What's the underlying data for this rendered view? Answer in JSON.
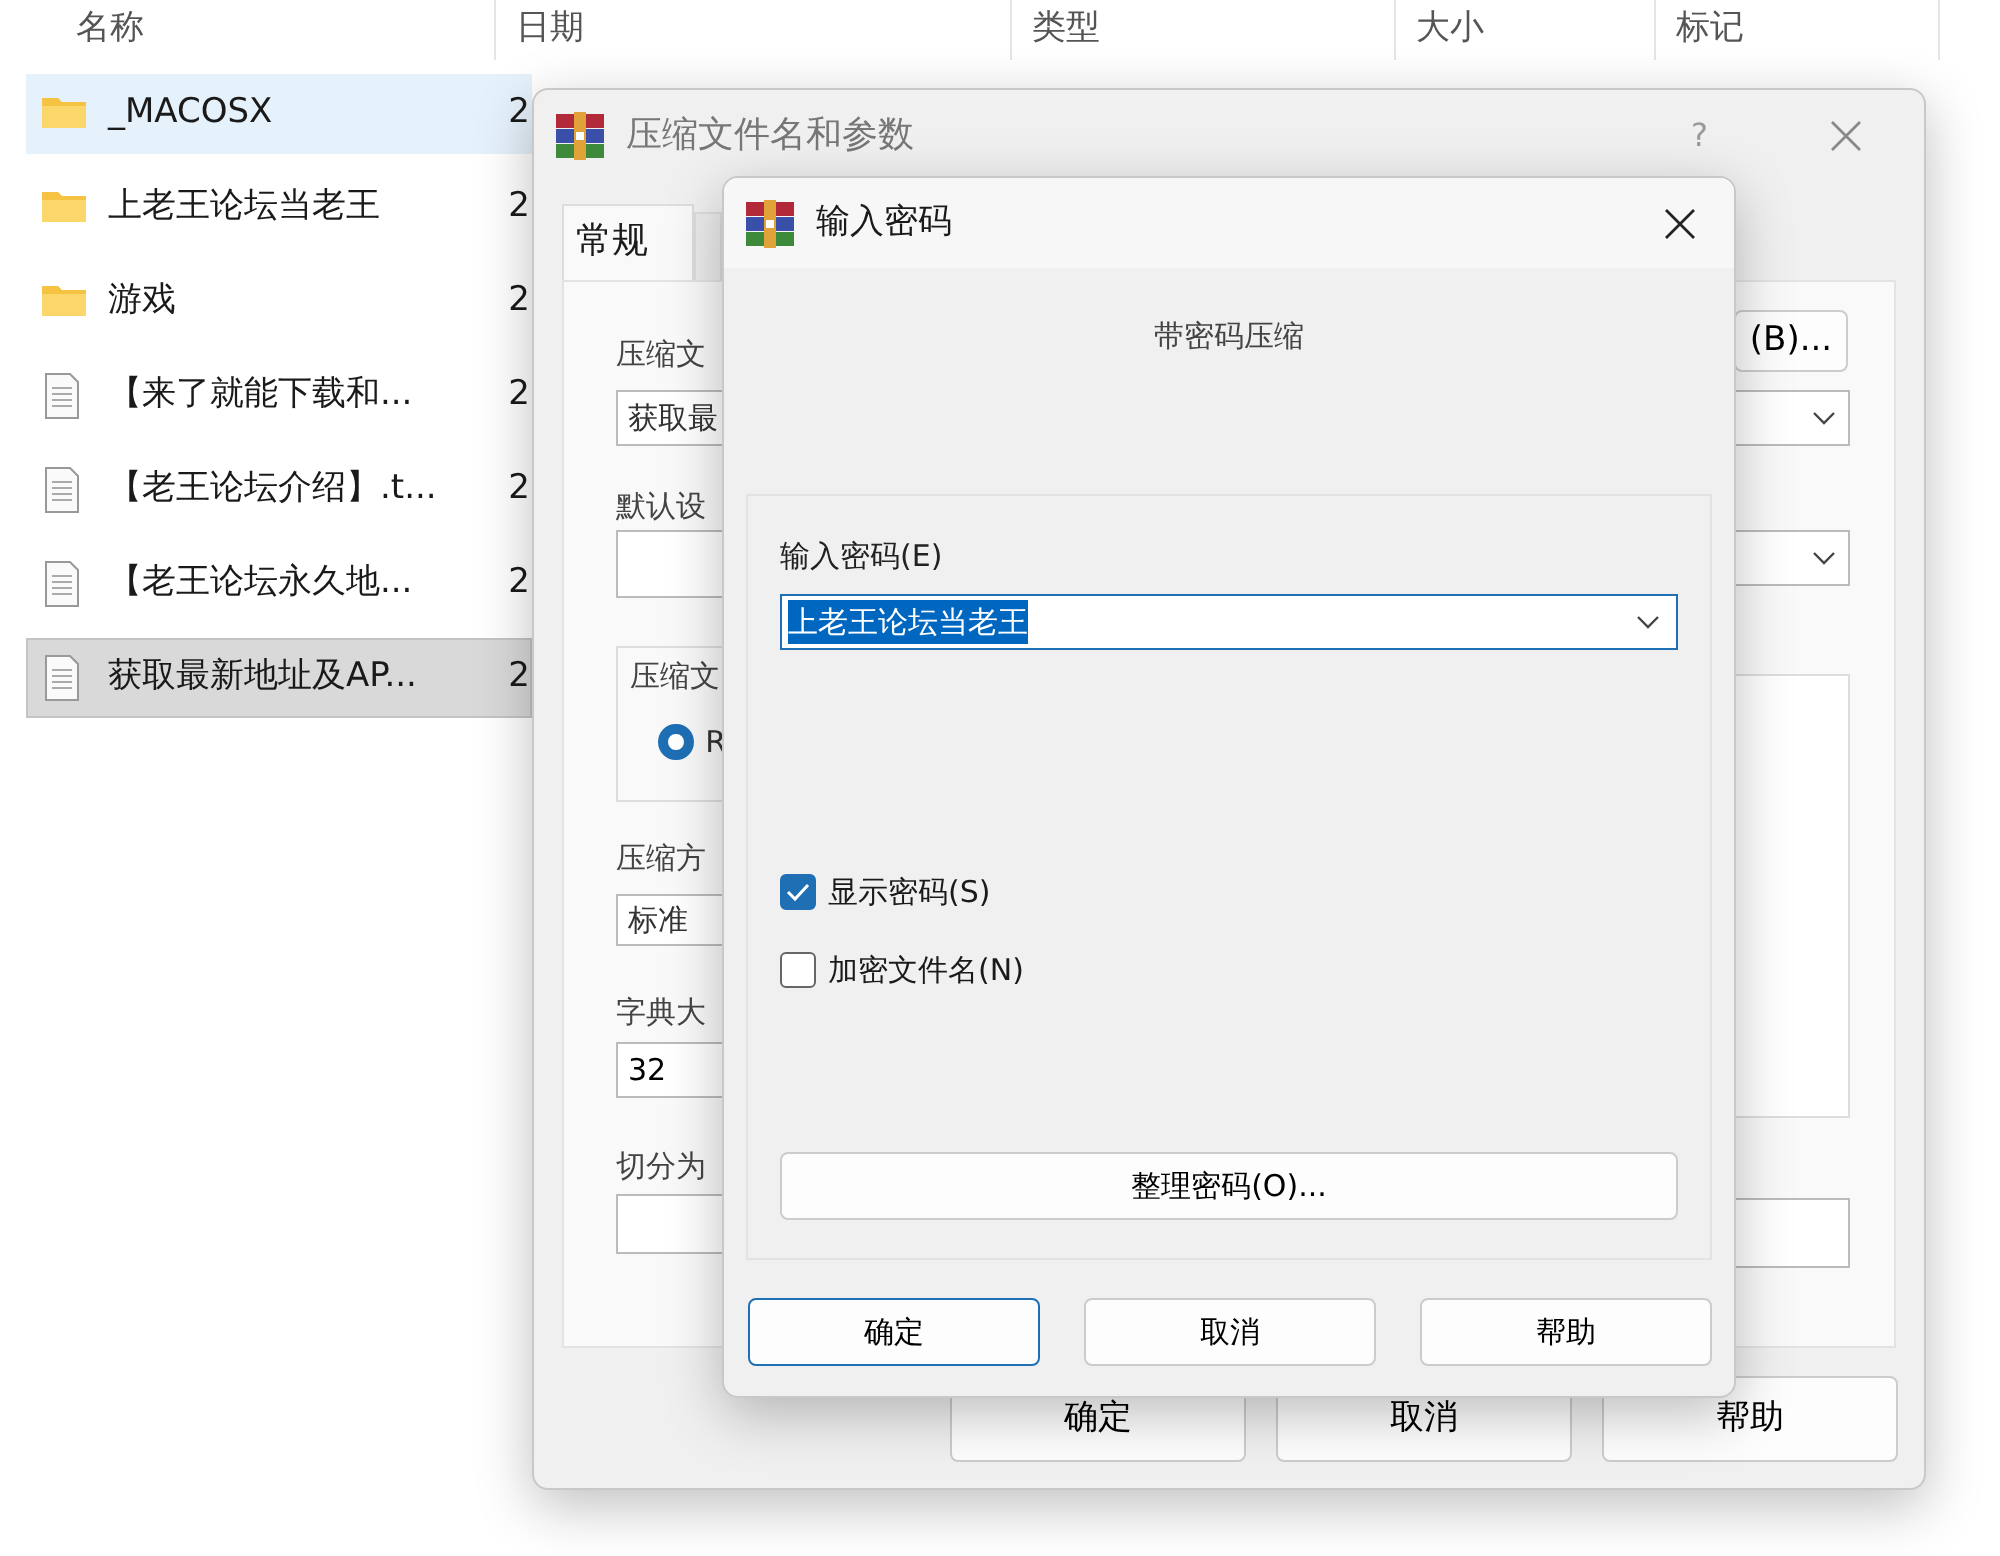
{
  "explorer": {
    "columns": [
      "名称",
      "日期",
      "类型",
      "大小",
      "标记"
    ],
    "rows": [
      {
        "kind": "folder",
        "name": "_MACOSX",
        "date": "2",
        "hovered": true,
        "selected": false
      },
      {
        "kind": "folder",
        "name": "上老王论坛当老王",
        "date": "2",
        "hovered": false,
        "selected": false
      },
      {
        "kind": "folder",
        "name": "游戏",
        "date": "2",
        "hovered": false,
        "selected": false
      },
      {
        "kind": "file",
        "name": "【来了就能下载和...",
        "date": "2",
        "hovered": false,
        "selected": false
      },
      {
        "kind": "file",
        "name": "【老王论坛介绍】.t...",
        "date": "2",
        "hovered": false,
        "selected": false
      },
      {
        "kind": "file",
        "name": "【老王论坛永久地...",
        "date": "2",
        "hovered": false,
        "selected": false
      },
      {
        "kind": "file",
        "name": "获取最新地址及AP...",
        "date": "2",
        "hovered": false,
        "selected": true
      }
    ]
  },
  "archive_dialog": {
    "title": "压缩文件名和参数",
    "help": "?",
    "tabs": [
      {
        "label": "常规",
        "selected": true
      },
      {
        "selected": false
      }
    ],
    "archive_label": "压缩文",
    "archive_value": "获取最",
    "browse_button": "(B)...",
    "profile_label": "默认设",
    "group_label": "压缩文",
    "radio": {
      "label": "R",
      "selected": true
    },
    "method_label": "压缩方",
    "method_value": "标准",
    "dict_label": "字典大",
    "dict_value": "32",
    "split_label": "切分为",
    "buttons": [
      "确定",
      "取消",
      "帮助"
    ]
  },
  "password_dialog": {
    "title": "输入密码",
    "subtitle": "带密码压缩",
    "password_label": "输入密码(E)",
    "password_value": "上老王论坛当老王",
    "checkboxes": [
      {
        "label": "显示密码(S)",
        "checked": true
      },
      {
        "label": "加密文件名(N)",
        "checked": false
      }
    ],
    "organize_button": "整理密码(O)...",
    "buttons": [
      {
        "label": "确定",
        "default": true
      },
      {
        "label": "取消",
        "default": false
      },
      {
        "label": "帮助",
        "default": false
      }
    ]
  }
}
